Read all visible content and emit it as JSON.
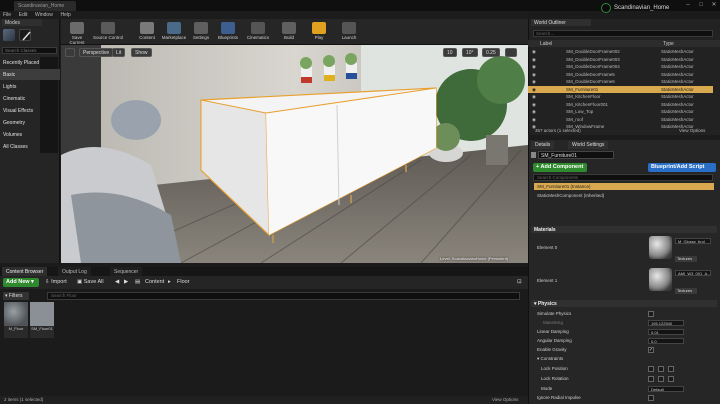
{
  "window": {
    "doc_tab": "Scandinavian_Home",
    "project_name": "Scandinavian_Home"
  },
  "menu": [
    "File",
    "Edit",
    "Window",
    "Help"
  ],
  "modes": {
    "tab": "Modes",
    "search_placeholder": "Search Classes",
    "categories": [
      "Recently Placed",
      "Basic",
      "Lights",
      "Cinematic",
      "Visual Effects",
      "Geometry",
      "Volumes",
      "All Classes"
    ],
    "selected_category": "Basic"
  },
  "toolbar": {
    "buttons": [
      "Save Current",
      "Source Control",
      "Content",
      "Marketplace",
      "Settings",
      "Blueprints",
      "Cinematics",
      "Build",
      "Play",
      "Launch"
    ]
  },
  "viewport": {
    "view_mode": "Perspective",
    "lighting": "Lit",
    "show": "Show",
    "grid": "10",
    "rotation": "10°",
    "scale": "0.25",
    "level_label": "Level: ScandinavianHome (Persistent)"
  },
  "content_browser": {
    "tabs": [
      "Content Browser",
      "Output Log",
      "Sequencer"
    ],
    "add_new": "Add New",
    "import": "Import",
    "save_all": "Save All",
    "path": [
      "Content",
      "Floor"
    ],
    "filters": "Filters",
    "search_placeholder": "Search Floor",
    "assets": [
      {
        "name": "M_Floor",
        "type": "material"
      },
      {
        "name": "SM_Floor01",
        "type": "mesh"
      }
    ],
    "status": "2 items (1 selected)",
    "view_options": "View Options"
  },
  "world_outliner": {
    "tab": "World Outliner",
    "search_placeholder": "Search...",
    "columns": [
      "Label",
      "Type"
    ],
    "rows": [
      {
        "label": "SM_DoubleDoorFrame002",
        "type": "StaticMeshActor"
      },
      {
        "label": "SM_DoubleDoorFrame003",
        "type": "StaticMeshActor"
      },
      {
        "label": "SM_DoubleDoorFrame004",
        "type": "StaticMeshActor"
      },
      {
        "label": "SM_DoubleDoorFrame5",
        "type": "StaticMeshActor"
      },
      {
        "label": "SM_DoubleDoorFrame6",
        "type": "StaticMeshActor"
      },
      {
        "label": "SM_Furniture01",
        "type": "StaticMeshActor"
      },
      {
        "label": "SM_KitchenFloor",
        "type": "StaticMeshActor"
      },
      {
        "label": "SM_KitchenFloor001",
        "type": "StaticMeshActor"
      },
      {
        "label": "SM_Low_Top",
        "type": "StaticMeshActor"
      },
      {
        "label": "SM_roof",
        "type": "StaticMeshActor"
      },
      {
        "label": "SM_WindowFrame",
        "type": "StaticMeshActor"
      }
    ],
    "selected_row": "SM_Furniture01",
    "count": "357 actors (1 selected)",
    "view_options": "View Options"
  },
  "details": {
    "tabs": [
      "Details",
      "World Settings"
    ],
    "actor_name": "SM_Furniture01",
    "add_component": "+ Add Component",
    "blueprint_script": "Blueprint/Add Script",
    "search_placeholder": "Search Components",
    "components": [
      "SM_Furniture01 (Instance)",
      "StaticMeshComponent (Inherited)"
    ],
    "materials_section": "Materials",
    "elements": [
      {
        "label": "Element 0",
        "material": "M_Glossy_brol",
        "textures": "Textures"
      },
      {
        "label": "Element 1",
        "material": "AMI_W3_001_A...",
        "textures": "Textures"
      }
    ],
    "physics_section": "Physics",
    "physics": {
      "simulate": "Simulate Physics",
      "mass": "MassInKg",
      "mass_value": "195.122540",
      "linear_damping": "Linear Damping",
      "linear_value": "0.01",
      "angular_damping": "Angular Damping",
      "angular_value": "0.0",
      "enable_gravity": "Enable Gravity",
      "constraints": "Constraints",
      "lock_position": "Lock Position",
      "lock_rotation": "Lock Rotation",
      "mode": "Mode",
      "mode_value": "Default",
      "ignore_radial": "Ignore Radial Impulse"
    }
  },
  "colors": {
    "selection": "#d9a950",
    "add_green": "#2f8a2f",
    "blueprint_blue": "#2a6fc7",
    "play_orange": "#e0a020"
  }
}
